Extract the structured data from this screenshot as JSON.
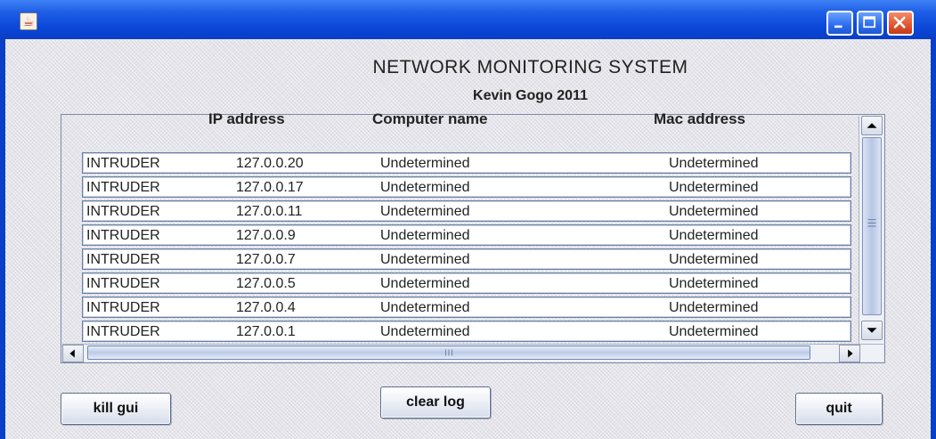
{
  "window": {
    "title_icon": "java-coffee-icon",
    "controls": [
      "minimize-icon",
      "maximize-icon",
      "close-icon"
    ]
  },
  "header": {
    "title": "NETWORK MONITORING SYSTEM",
    "subtitle": "Kevin Gogo 2011"
  },
  "table": {
    "columns": [
      "IP address",
      "Computer name",
      "Mac address"
    ],
    "rows": [
      {
        "status": "INTRUDER",
        "ip": "127.0.0.20",
        "name": "Undetermined",
        "mac": "Undetermined"
      },
      {
        "status": "INTRUDER",
        "ip": "127.0.0.17",
        "name": "Undetermined",
        "mac": "Undetermined"
      },
      {
        "status": "INTRUDER",
        "ip": "127.0.0.11",
        "name": "Undetermined",
        "mac": "Undetermined"
      },
      {
        "status": "INTRUDER",
        "ip": "127.0.0.9",
        "name": "Undetermined",
        "mac": "Undetermined"
      },
      {
        "status": "INTRUDER",
        "ip": "127.0.0.7",
        "name": "Undetermined",
        "mac": "Undetermined"
      },
      {
        "status": "INTRUDER",
        "ip": "127.0.0.5",
        "name": "Undetermined",
        "mac": "Undetermined"
      },
      {
        "status": "INTRUDER",
        "ip": "127.0.0.4",
        "name": "Undetermined",
        "mac": "Undetermined"
      },
      {
        "status": "INTRUDER",
        "ip": "127.0.0.1",
        "name": "Undetermined",
        "mac": "Undetermined"
      }
    ]
  },
  "buttons": {
    "kill_gui": "kill gui",
    "clear_log": "clear log",
    "quit": "quit"
  },
  "colors": {
    "titlebar": "#0b47d8",
    "close_button": "#e0542f",
    "row_border": "#6a7fa2"
  }
}
